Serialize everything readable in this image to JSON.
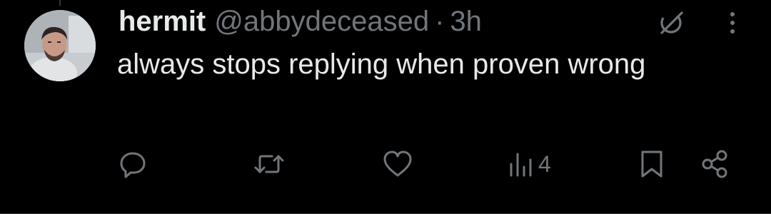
{
  "tweet": {
    "display_name": "hermit",
    "handle": "@abbydeceased",
    "separator": "·",
    "time": "3h",
    "text": "always stops replying when proven wrong",
    "views_count": "4"
  },
  "icons": {
    "grok": "grok-icon",
    "more": "more-vertical-icon",
    "reply": "reply-icon",
    "repost": "repost-icon",
    "like": "heart-icon",
    "views": "views-icon",
    "bookmark": "bookmark-icon",
    "share": "share-icon"
  },
  "colors": {
    "background": "#000000",
    "primary_text": "#e7e9ea",
    "secondary_text": "#71767b"
  }
}
